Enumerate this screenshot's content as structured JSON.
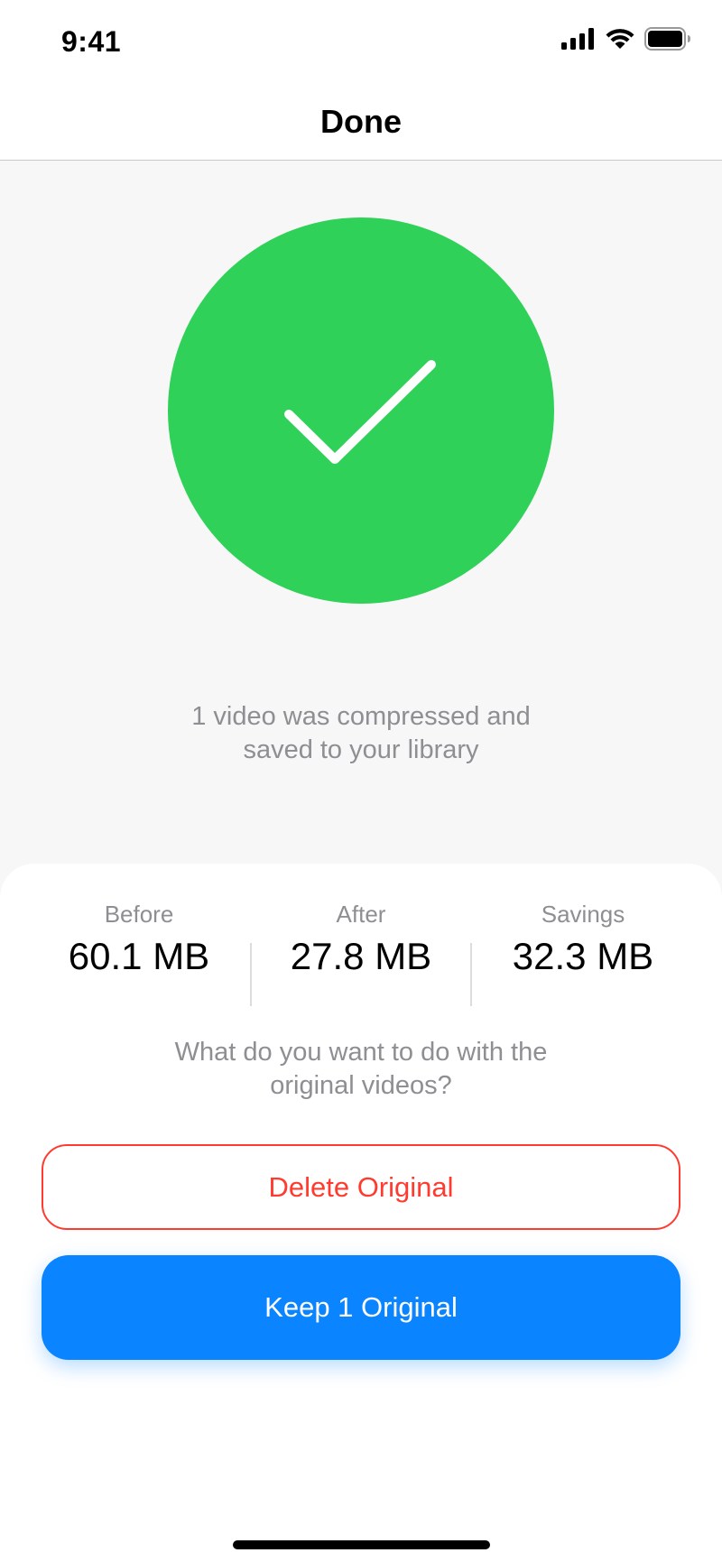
{
  "status_bar": {
    "time": "9:41",
    "icons": [
      "cellular-signal-icon",
      "wifi-icon",
      "battery-icon"
    ]
  },
  "nav": {
    "title": "Done"
  },
  "success": {
    "icon": "checkmark-icon",
    "color": "#30d158",
    "message_line1": "1 video was compressed and",
    "message_line2": "saved to your library"
  },
  "stats": [
    {
      "label": "Before",
      "value": "60.1 MB"
    },
    {
      "label": "After",
      "value": "27.8 MB"
    },
    {
      "label": "Savings",
      "value": "32.3 MB"
    }
  ],
  "question": {
    "line1": "What do you want to do with the",
    "line2": "original videos?"
  },
  "actions": {
    "delete_label": "Delete Original",
    "delete_color": "#ff3b30",
    "keep_label": "Keep 1 Original",
    "keep_color": "#0a84ff"
  }
}
